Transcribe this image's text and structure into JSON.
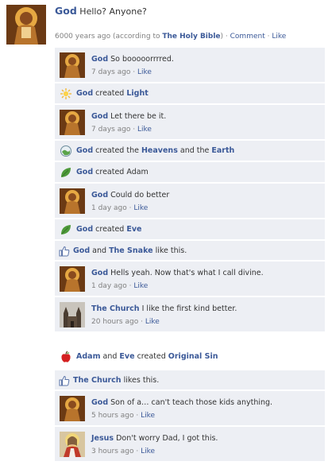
{
  "post": {
    "author": "God",
    "text": "Hello?  Anyone?",
    "age": "6000 years ago (according to ",
    "source": "The Holy Bible",
    "close": ")",
    "sep1": " · ",
    "comment_label": "Comment",
    "sep2": " · ",
    "like_label": "Like"
  },
  "items": [
    {
      "author": "God",
      "text": "So booooorrrred.",
      "time": "7 days ago",
      "like": "Like"
    },
    {
      "actor": "God",
      "verb": "created",
      "object": "Light"
    },
    {
      "author": "God",
      "text": "Let there be it.",
      "time": "7 days ago",
      "like": "Like"
    },
    {
      "actor": "God",
      "verb": "created the",
      "object": "Heavens",
      "mid": "and the",
      "object2": "Earth"
    },
    {
      "actor": "God",
      "verb": "created Adam"
    },
    {
      "author": "God",
      "text": "Could do better",
      "time": "1 day ago",
      "like": "Like"
    },
    {
      "actor": "God",
      "verb": "created",
      "object": "Eve"
    },
    {
      "actor": "God",
      "mid": "and",
      "actor2": "The Snake",
      "verb": "like this."
    },
    {
      "author": "God",
      "text": "Hells yeah.  Now that's what I call divine.",
      "time": "1 day ago",
      "like": "Like"
    },
    {
      "author": "The Church",
      "text": "I like the first kind better.",
      "time": "20 hours ago",
      "like": "Like"
    },
    {
      "actor": "Adam",
      "mid": "and",
      "actor2": "Eve",
      "verb": "created",
      "object": "Original Sin"
    },
    {
      "actor": "The Church",
      "verb": "likes this."
    },
    {
      "author": "God",
      "text": "Son of a… can't teach those kids anything.",
      "time": "5 hours ago",
      "like": "Like"
    },
    {
      "author": "Jesus",
      "text": "Don't worry Dad, I got this.",
      "time": "3 hours ago",
      "like": "Like"
    }
  ],
  "icons": {
    "sun": "sun-icon",
    "globe": "globe-icon",
    "leaf": "leaf-icon",
    "thumb": "thumbs-up-icon",
    "apple": "apple-icon"
  },
  "colors": {
    "link": "#3b5998",
    "row_bg": "#edeff4",
    "meta": "#808080"
  }
}
